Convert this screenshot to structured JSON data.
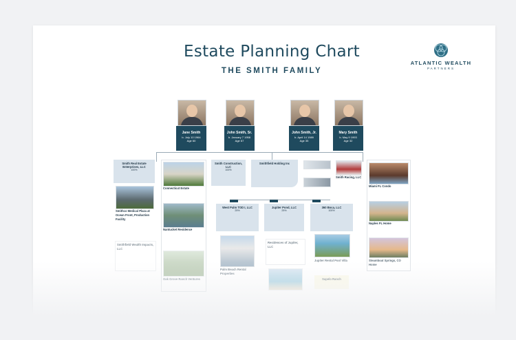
{
  "header": {
    "title": "Estate Planning Chart",
    "subtitle": "THE SMITH FAMILY",
    "logo_line1": "ATLANTIC WEALTH",
    "logo_line2": "PARTNERS"
  },
  "family": [
    {
      "name": "Jane Smith",
      "line1": "b. July 10 1964",
      "line2": "Age 60"
    },
    {
      "name": "John Smith, Sr.",
      "line1": "b. January 7 1958",
      "line2": "Age 67"
    },
    {
      "name": "John Smith, Jr.",
      "line1": "b. April 14 1989",
      "line2": "Age 35"
    },
    {
      "name": "Mary Smith",
      "line1": "b. May 9 1993",
      "line2": "Age 32"
    }
  ],
  "entities": {
    "smith_real_estate": {
      "name": "Smith Real Estate Enterprises, LLC",
      "pct": "100%"
    },
    "smith_construction": {
      "name": "Smith Construction, LLC",
      "pct": "100%"
    },
    "smithfield": {
      "name": "Smithfield Holding Inc"
    },
    "smith_racing": {
      "name": "Smith Racing, LLC"
    },
    "west_palm": {
      "name": "West Palm TOD I, LLC",
      "pct": "25%"
    },
    "jupiter_pond": {
      "name": "Jupiter Pond, LLC",
      "pct": "25%"
    },
    "boca_360": {
      "name": "360 Boca, LLC",
      "pct": "100%"
    },
    "smithfield_wealth": {
      "name": "Smithfield Wealth Impacts, LLC"
    },
    "residences_jupiter": {
      "name": "Residences of Jupiter, LLC"
    }
  },
  "properties": {
    "smithco_medical": "Smithco Medical Plaza at Ocean Front, Production Facility",
    "connecticut_estate": "Connecticut Estate",
    "nantucket": "Nantucket Residence",
    "miami_condo": "Miami FL Condo",
    "naples": "Naples FL Home",
    "oak_grove": "Oak Grove Ranch Ventures",
    "palm_beach_rental": "Palm Beach Rental Properties",
    "jupiter_pool": "Jupiter Rental Pool Villa",
    "sapelo_ranch": "Sapelo Ranch",
    "seaside": "Seaside Village",
    "steamboat": "Steamboat Springs, CO Home"
  },
  "colors": {
    "brand": "#1f4a5e",
    "entity_fill": "#d9e3ec",
    "page_bg": "#f1f2f4"
  }
}
